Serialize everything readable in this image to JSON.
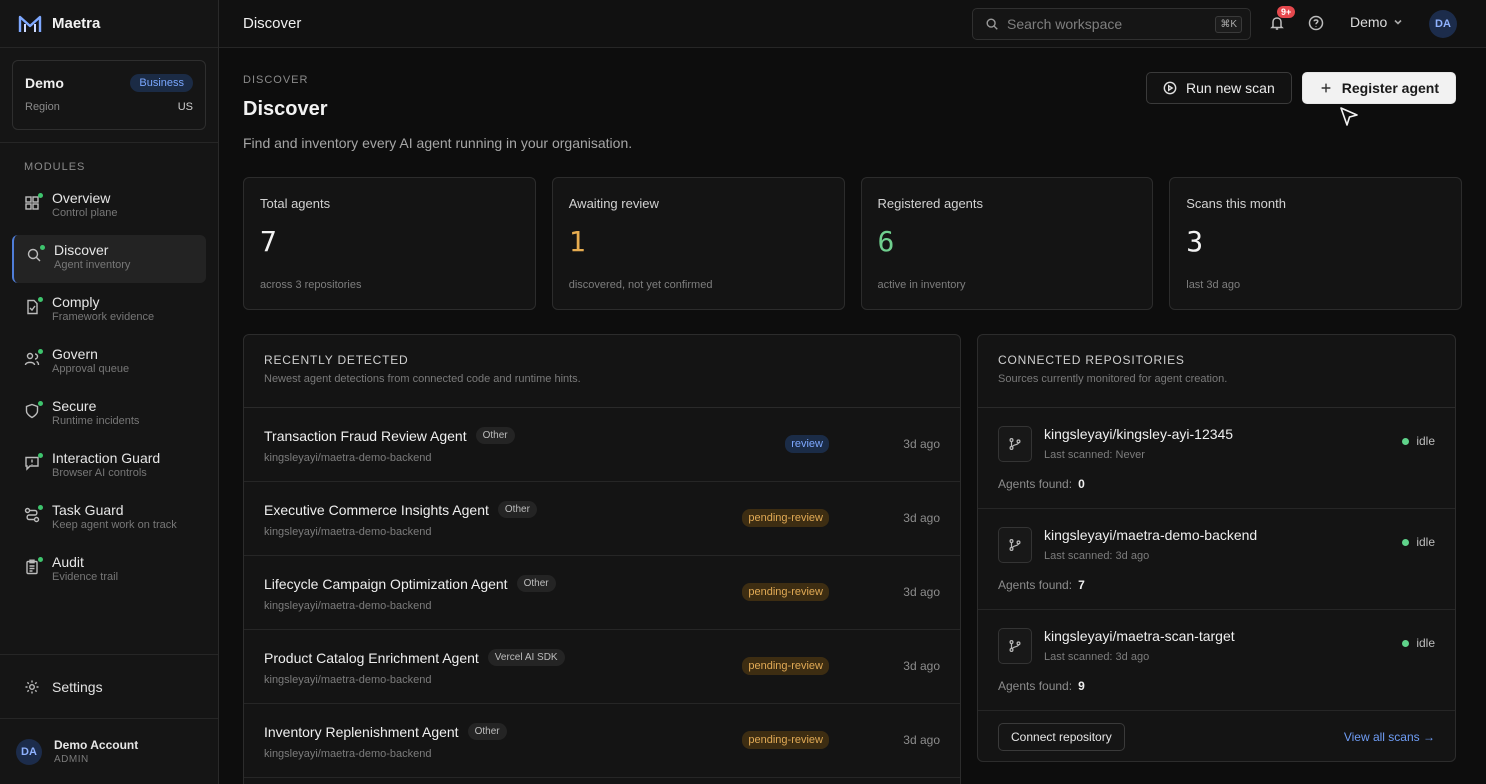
{
  "brand": {
    "name": "Maetra"
  },
  "org": {
    "name": "Demo",
    "plan": "Business",
    "region_label": "Region",
    "region_value": "US"
  },
  "sidebar": {
    "modules_label": "MODULES",
    "items": [
      {
        "title": "Overview",
        "sub": "Control plane",
        "icon": "grid-icon"
      },
      {
        "title": "Discover",
        "sub": "Agent inventory",
        "icon": "search-icon"
      },
      {
        "title": "Comply",
        "sub": "Framework evidence",
        "icon": "document-icon"
      },
      {
        "title": "Govern",
        "sub": "Approval queue",
        "icon": "users-icon"
      },
      {
        "title": "Secure",
        "sub": "Runtime incidents",
        "icon": "shield-icon"
      },
      {
        "title": "Interaction Guard",
        "sub": "Browser AI controls",
        "icon": "message-alert-icon"
      },
      {
        "title": "Task Guard",
        "sub": "Keep agent work on track",
        "icon": "route-icon"
      },
      {
        "title": "Audit",
        "sub": "Evidence trail",
        "icon": "clipboard-icon"
      }
    ],
    "settings_label": "Settings",
    "account": {
      "initials": "DA",
      "name": "Demo Account",
      "role": "ADMIN"
    }
  },
  "topbar": {
    "title": "Discover",
    "search_placeholder": "Search workspace",
    "search_shortcut": "⌘K",
    "notifications_badge": "9+",
    "workspace": "Demo",
    "avatar_initials": "DA"
  },
  "page": {
    "eyebrow": "DISCOVER",
    "title": "Discover",
    "description": "Find and inventory every AI agent running in your organisation.",
    "run_scan_label": "Run new scan",
    "register_label": "Register agent"
  },
  "stats": [
    {
      "label": "Total agents",
      "value": "7",
      "sub": "across 3 repositories"
    },
    {
      "label": "Awaiting review",
      "value": "1",
      "sub": "discovered, not yet confirmed"
    },
    {
      "label": "Registered agents",
      "value": "6",
      "sub": "active in inventory"
    },
    {
      "label": "Scans this month",
      "value": "3",
      "sub": "last 3d ago"
    }
  ],
  "recent": {
    "title": "RECENTLY DETECTED",
    "subtitle": "Newest agent detections from connected code and runtime hints.",
    "rows": [
      {
        "name": "Transaction Fraud Review Agent",
        "framework": "Other",
        "repo": "kingsleyayi/maetra-demo-backend",
        "status": "review",
        "time": "3d ago"
      },
      {
        "name": "Executive Commerce Insights Agent",
        "framework": "Other",
        "repo": "kingsleyayi/maetra-demo-backend",
        "status": "pending-review",
        "time": "3d ago"
      },
      {
        "name": "Lifecycle Campaign Optimization Agent",
        "framework": "Other",
        "repo": "kingsleyayi/maetra-demo-backend",
        "status": "pending-review",
        "time": "3d ago"
      },
      {
        "name": "Product Catalog Enrichment Agent",
        "framework": "Vercel AI SDK",
        "repo": "kingsleyayi/maetra-demo-backend",
        "status": "pending-review",
        "time": "3d ago"
      },
      {
        "name": "Inventory Replenishment Agent",
        "framework": "Other",
        "repo": "kingsleyayi/maetra-demo-backend",
        "status": "pending-review",
        "time": "3d ago"
      }
    ]
  },
  "repos": {
    "title": "CONNECTED REPOSITORIES",
    "subtitle": "Sources currently monitored for agent creation.",
    "agents_label": "Agents found:",
    "rows": [
      {
        "name": "kingsleyayi/kingsley-ayi-12345",
        "scanned": "Last scanned: Never",
        "status": "idle",
        "agents": "0"
      },
      {
        "name": "kingsleyayi/maetra-demo-backend",
        "scanned": "Last scanned: 3d ago",
        "status": "idle",
        "agents": "7"
      },
      {
        "name": "kingsleyayi/maetra-scan-target",
        "scanned": "Last scanned: 3d ago",
        "status": "idle",
        "agents": "9"
      }
    ],
    "connect_label": "Connect repository",
    "view_all_label": "View all scans →"
  },
  "colors": {
    "accent": "#4f7dd8",
    "amber": "#e6ac50",
    "green": "#6fcf8e",
    "idle": "#5fd38a"
  }
}
